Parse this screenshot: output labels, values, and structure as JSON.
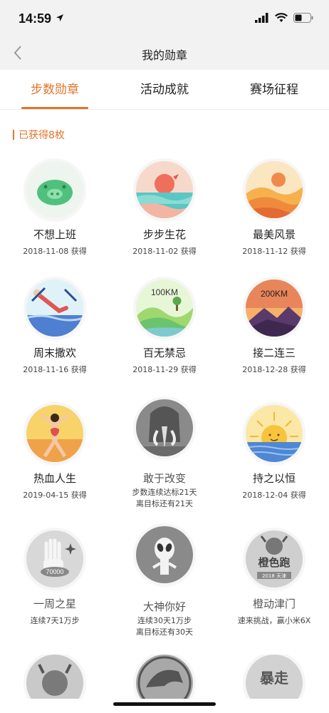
{
  "status": {
    "time": "14:59"
  },
  "nav": {
    "title": "我的勋章"
  },
  "tabs": [
    {
      "label": "步数勋章",
      "active": true
    },
    {
      "label": "活动成就",
      "active": false
    },
    {
      "label": "赛场征程",
      "active": false
    }
  ],
  "section": {
    "label": "已获得8枚"
  },
  "colors": {
    "accent": "#e0742c"
  },
  "badges": [
    {
      "name": "不想上班",
      "line1": "2018-11-08 获得",
      "line2": "",
      "earned": true,
      "icon": "pig-icon"
    },
    {
      "name": "步步生花",
      "line1": "2018-11-02 获得",
      "line2": "",
      "earned": true,
      "icon": "sunset-sea-icon"
    },
    {
      "name": "最美风景",
      "line1": "2018-11-12 获得",
      "line2": "",
      "earned": true,
      "icon": "desert-icon"
    },
    {
      "name": "周末撒欢",
      "line1": "2018-11-16 获得",
      "line2": "",
      "earned": true,
      "icon": "swimmer-icon"
    },
    {
      "name": "百无禁忌",
      "line1": "2018-11-29 获得",
      "line2": "",
      "earned": true,
      "icon": "hills-icon",
      "badge_text": "100KM"
    },
    {
      "name": "接二连三",
      "line1": "2018-12-28 获得",
      "line2": "",
      "earned": true,
      "icon": "mountain-icon",
      "badge_text": "200KM"
    },
    {
      "name": "热血人生",
      "line1": "2019-04-15 获得",
      "line2": "",
      "earned": true,
      "icon": "hero-icon"
    },
    {
      "name": "敢于改变",
      "line1": "步数连续达标21天",
      "line2": "离目标还有21天",
      "earned": false,
      "icon": "mammoth-icon"
    },
    {
      "name": "持之以恒",
      "line1": "2018-12-04 获得",
      "line2": "",
      "earned": true,
      "icon": "sunrise-icon"
    },
    {
      "name": "一周之星",
      "line1": "连续7天1万步",
      "line2": "",
      "earned": false,
      "icon": "hand-icon",
      "badge_text": "70000"
    },
    {
      "name": "大神你好",
      "line1": "连续30天1万步",
      "line2": "离目标还有30天",
      "earned": false,
      "icon": "alien-icon"
    },
    {
      "name": "橙动津门",
      "line1": "速来挑战，赢小米6X",
      "line2": "",
      "earned": false,
      "icon": "tianjin-icon",
      "badge_text": "橙色跑",
      "badge_subtext": "2018 天津"
    },
    {
      "name": "",
      "line1": "",
      "line2": "",
      "earned": false,
      "icon": "creature-icon"
    },
    {
      "name": "",
      "line1": "",
      "line2": "",
      "earned": false,
      "icon": "dinosaur-icon"
    },
    {
      "name": "",
      "line1": "",
      "line2": "",
      "earned": false,
      "icon": "baozou-icon",
      "badge_text": "暴走"
    }
  ]
}
